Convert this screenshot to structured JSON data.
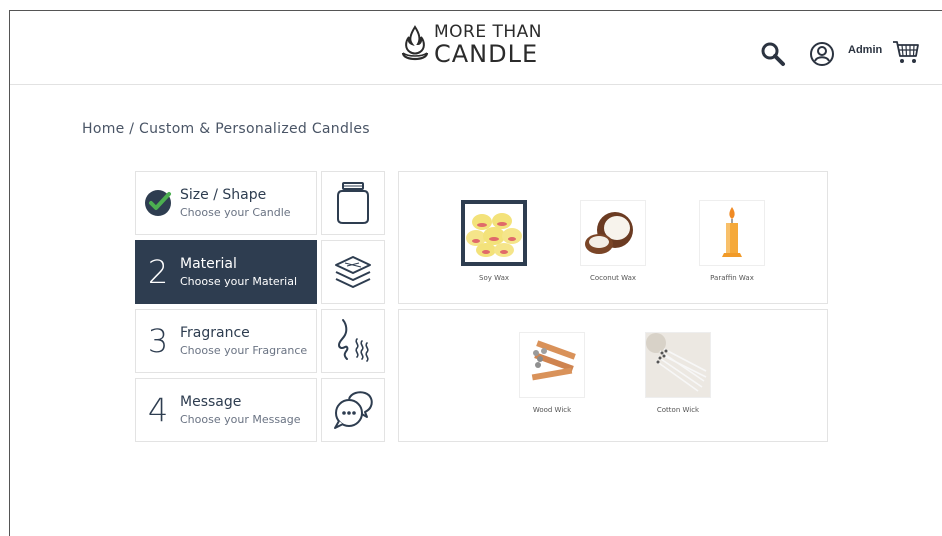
{
  "header": {
    "logo_line1": "MORE THAN",
    "logo_line2": "CANDLE",
    "user_label": "Admin",
    "icons": [
      "flame-logo-icon",
      "search-icon",
      "user-icon",
      "cart-icon"
    ]
  },
  "breadcrumb": "Home / Custom & Personalized Candles",
  "steps": [
    {
      "number": "",
      "title": "Size / Shape",
      "subtitle": "Choose your Candle",
      "status": "completed",
      "icon": "jar-icon"
    },
    {
      "number": "2",
      "title": "Material",
      "subtitle": "Choose your Material",
      "status": "active",
      "icon": "layers-icon"
    },
    {
      "number": "3",
      "title": "Fragrance",
      "subtitle": "Choose your Fragrance",
      "status": "pending",
      "icon": "smell-icon"
    },
    {
      "number": "4",
      "title": "Message",
      "subtitle": "Choose your Message",
      "status": "pending",
      "icon": "chat-bubbles-icon"
    }
  ],
  "wax_options": [
    {
      "label": "Soy Wax",
      "selected": true
    },
    {
      "label": "Coconut Wax",
      "selected": false
    },
    {
      "label": "Paraffin Wax",
      "selected": false
    }
  ],
  "wick_options": [
    {
      "label": "Wood Wick",
      "selected": false
    },
    {
      "label": "Cotton Wick",
      "selected": false
    }
  ],
  "colors": {
    "accent": "#2e3d50",
    "check_green": "#4caf50"
  }
}
